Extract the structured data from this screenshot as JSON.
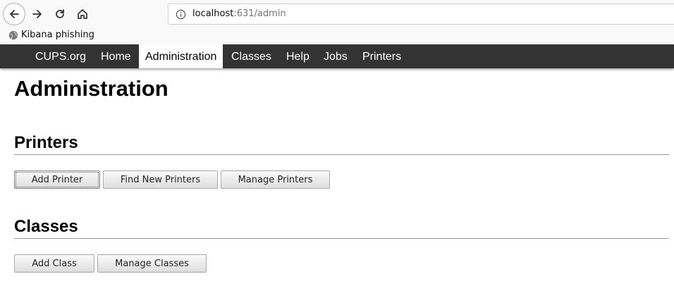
{
  "browser": {
    "url_host": "localhost",
    "url_path": ":631/admin",
    "bookmark_label": "Kibana phishing"
  },
  "nav": {
    "items": [
      {
        "label": "CUPS.org"
      },
      {
        "label": "Home"
      },
      {
        "label": "Administration"
      },
      {
        "label": "Classes"
      },
      {
        "label": "Help"
      },
      {
        "label": "Jobs"
      },
      {
        "label": "Printers"
      }
    ],
    "active": "Administration"
  },
  "page": {
    "title": "Administration",
    "printers": {
      "heading": "Printers",
      "buttons": [
        "Add Printer",
        "Find New Printers",
        "Manage Printers"
      ]
    },
    "classes": {
      "heading": "Classes",
      "buttons": [
        "Add Class",
        "Manage Classes"
      ]
    }
  },
  "colors": {
    "nav_bg": "#333333",
    "active_tab_bg": "#ffffff"
  }
}
